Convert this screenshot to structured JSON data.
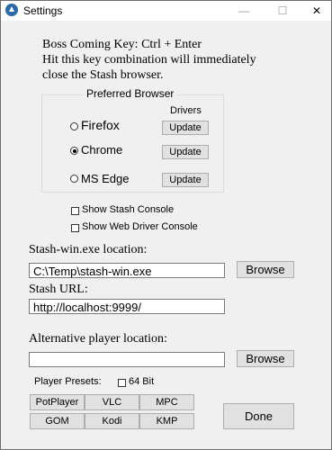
{
  "window": {
    "title": "Settings",
    "close_icon": "close-icon"
  },
  "boss_key": {
    "line1": "Boss Coming Key: Ctrl + Enter",
    "line2": "Hit this key combination will immediately",
    "line3": "close the Stash browser."
  },
  "browser": {
    "group_label": "Preferred Browser",
    "drivers_label": "Drivers",
    "options": [
      {
        "label": "Firefox",
        "selected": false,
        "update_label": "Update"
      },
      {
        "label": "Chrome",
        "selected": true,
        "update_label": "Update"
      },
      {
        "label": "MS Edge",
        "selected": false,
        "update_label": "Update"
      }
    ]
  },
  "options": {
    "show_console_label": "Show Stash Console",
    "show_console_checked": false,
    "show_webdriver_label": "Show Web Driver Console",
    "show_webdriver_checked": false
  },
  "exe": {
    "label": "Stash-win.exe location:",
    "value": "C:\\Temp\\stash-win.exe",
    "browse_label": "Browse"
  },
  "url": {
    "label": "Stash URL:",
    "value": "http://localhost:9999/"
  },
  "alt_player": {
    "label": "Alternative player location:",
    "value": "",
    "browse_label": "Browse"
  },
  "presets": {
    "label": "Player Presets:",
    "bit64_label": "64 Bit",
    "bit64_checked": false,
    "buttons": [
      "PotPlayer",
      "VLC",
      "MPC",
      "GOM",
      "Kodi",
      "KMP"
    ]
  },
  "done_label": "Done"
}
